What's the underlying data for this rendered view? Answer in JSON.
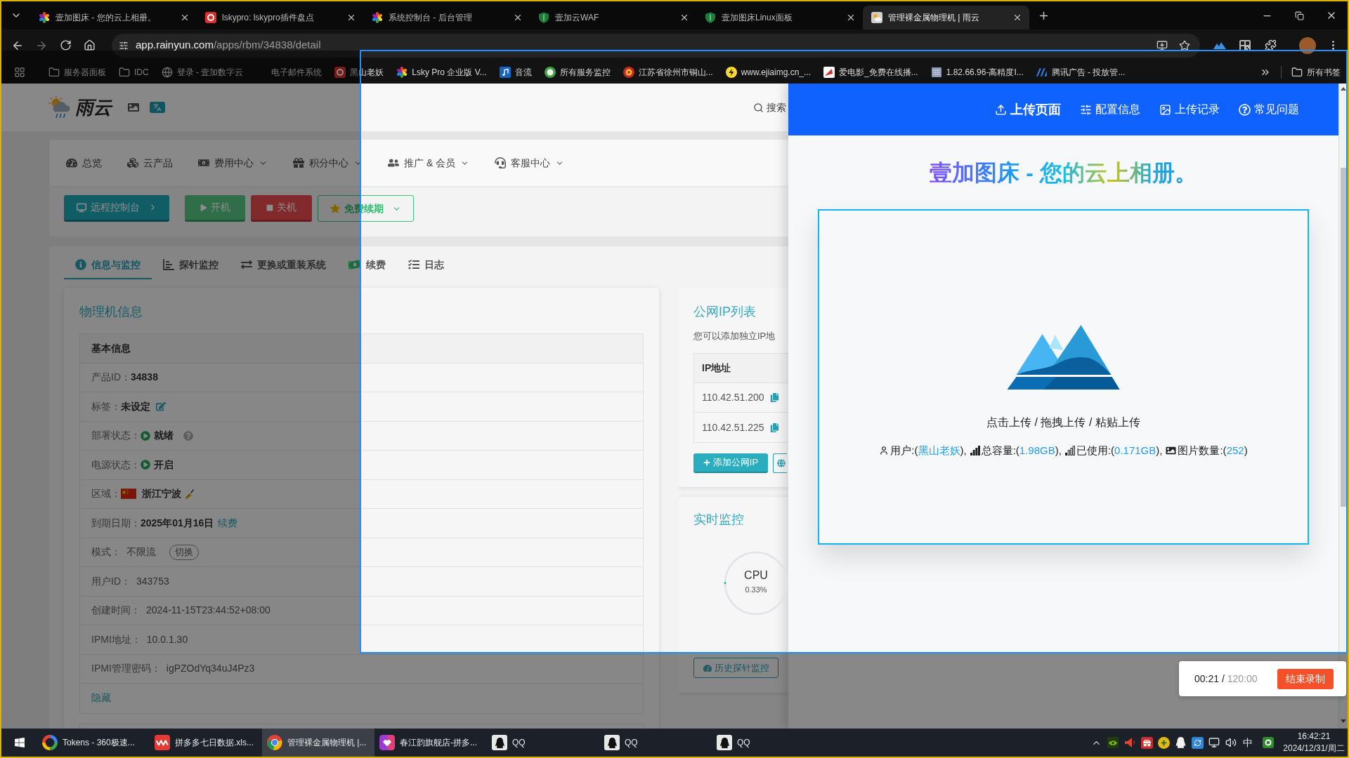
{
  "browser": {
    "tabs": [
      {
        "title": "壹加图床 - 您的云上相册。",
        "kind": "pinwheel",
        "selected": false
      },
      {
        "title": "lskypro: lskypro插件盘点",
        "kind": "badge",
        "selected": false
      },
      {
        "title": "系统控制台 - 后台管理",
        "kind": "pinwheel",
        "selected": false
      },
      {
        "title": "壹加云WAF",
        "kind": "shield",
        "selected": false
      },
      {
        "title": "壹加图床Linux面板",
        "kind": "shield",
        "selected": false
      },
      {
        "title": "管理裸金属物理机 | 雨云",
        "kind": "cloud",
        "selected": true
      }
    ],
    "address": {
      "host": "app.rainyun.com",
      "path": "/apps/rbm/34838/detail"
    },
    "bookmarks": [
      {
        "label": "服务器面板",
        "kind": "folder"
      },
      {
        "label": "IDC",
        "kind": "folder"
      },
      {
        "label": "登录 - 壹加数字云",
        "kind": "globe"
      },
      {
        "label": "电子邮件系统",
        "kind": "blank"
      },
      {
        "label": "黑山老妖",
        "kind": "badge"
      },
      {
        "label": "Lsky Pro 企业版 V...",
        "kind": "pinwheel"
      },
      {
        "label": "音流",
        "kind": "music"
      },
      {
        "label": "所有服务监控",
        "kind": "dot"
      },
      {
        "label": "江苏省徐州市铜山...",
        "kind": "emblem"
      },
      {
        "label": "www.ejiaimg.cn_...",
        "kind": "bolt"
      },
      {
        "label": "爱电影_免费在线播...",
        "kind": "tile"
      },
      {
        "label": "1.82.66.96-高精度I...",
        "kind": "server"
      },
      {
        "label": "腾讯广告 - 投放管...",
        "kind": "stripes"
      }
    ],
    "all_bookmarks": "所有书签"
  },
  "site": {
    "logo": "雨云",
    "search": "搜索",
    "nav": [
      {
        "label": "总览",
        "has_menu": false
      },
      {
        "label": "云产品",
        "has_menu": false
      },
      {
        "label": "费用中心",
        "has_menu": true
      },
      {
        "label": "积分中心",
        "has_menu": true
      },
      {
        "label": "推广 & 会员",
        "has_menu": true
      },
      {
        "label": "客服中心",
        "has_menu": true
      }
    ],
    "actions": [
      {
        "label": "远程控制台",
        "kind": "primary"
      },
      {
        "label": "开机",
        "kind": "success"
      },
      {
        "label": "关机",
        "kind": "danger"
      },
      {
        "label": "免费续期",
        "kind": "outline"
      }
    ],
    "tabs": [
      {
        "label": "信息与监控",
        "selected": true
      },
      {
        "label": "探针监控",
        "selected": false
      },
      {
        "label": "更换或重装系统",
        "selected": false
      },
      {
        "label": "续费",
        "selected": false
      },
      {
        "label": "日志",
        "selected": false
      }
    ],
    "info": {
      "title": "物理机信息",
      "rows": [
        {
          "kind": "header",
          "label": "基本信息"
        },
        {
          "kind": "field",
          "label": "产品ID：",
          "value": "34838",
          "bold": true
        },
        {
          "kind": "tag",
          "label": "标签：",
          "value": "未设定",
          "bold": true
        },
        {
          "kind": "status",
          "label": "部署状态：",
          "value": "就绪",
          "bold": true,
          "help": true
        },
        {
          "kind": "status",
          "label": "电源状态：",
          "value": "开启",
          "bold": true,
          "help": false
        },
        {
          "kind": "region",
          "label": "区域：",
          "value": "浙江宁波",
          "bold": true
        },
        {
          "kind": "field",
          "label": "到期日期：",
          "value": "2025年01月16日",
          "bold": true,
          "link": "续费"
        },
        {
          "kind": "field",
          "label": "模式：",
          "value": "不限流",
          "bold": false,
          "button": "切换"
        },
        {
          "kind": "field",
          "label": "用户ID：",
          "value": "343753",
          "bold": false
        },
        {
          "kind": "field",
          "label": "创建时间：",
          "value": "2024-11-15T23:44:52+08:00",
          "bold": false
        },
        {
          "kind": "field",
          "label": "IPMI地址：",
          "value": "10.0.1.30",
          "bold": false
        },
        {
          "kind": "field",
          "label": "IPMI管理密码：",
          "value": "igPZOdYq34uJ4Pz3",
          "bold": false
        },
        {
          "kind": "link",
          "label": "隐藏"
        }
      ]
    },
    "ip": {
      "title": "公网IP列表",
      "note": "您可以添加独立IP地",
      "column": "IP地址",
      "rows": [
        "110.42.51.200",
        "110.42.51.225"
      ],
      "add_button": "添加公网IP"
    },
    "monitor": {
      "title": "实时监控",
      "gauge": {
        "label": "CPU",
        "reading": "0.33%",
        "level": 0.0033
      },
      "history_button": "历史探针监控"
    }
  },
  "uploader": {
    "tabs": [
      {
        "label": "上传页面",
        "selected": true
      },
      {
        "label": "配置信息",
        "selected": false
      },
      {
        "label": "上传记录",
        "selected": false
      },
      {
        "label": "常见问题",
        "selected": false
      }
    ],
    "title": "壹加图床 - 您的云上相册。",
    "hint": "点击上传 / 拖拽上传 / 粘贴上传",
    "stats": [
      {
        "label": "用户:(",
        "value": "黑山老妖",
        "close": "),"
      },
      {
        "label": "总容量:(",
        "value": "1.98GB",
        "close": "),"
      },
      {
        "label": "已使用:(",
        "value": "0.171GB",
        "close": "),"
      },
      {
        "label": "图片数量:(",
        "value": "252",
        "close": ")"
      }
    ]
  },
  "recorder": {
    "elapsed": "00:21",
    "divider": "/",
    "limit": "120:00",
    "stop_button": "结束录制"
  },
  "taskbar": {
    "items": [
      {
        "label": "Tokens - 360极速...",
        "kind": "ring",
        "selected": false
      },
      {
        "label": "拼多多七日数据.xls...",
        "kind": "zigzag",
        "selected": false
      },
      {
        "label": "管理裸金属物理机 |...",
        "kind": "browser",
        "selected": true
      },
      {
        "label": "春江韵旗舰店-拼多...",
        "kind": "store",
        "selected": false
      },
      {
        "label": "QQ",
        "kind": "penguin",
        "selected": false
      },
      {
        "label": "QQ",
        "kind": "penguin",
        "selected": false
      },
      {
        "label": "QQ",
        "kind": "penguin",
        "selected": false
      }
    ],
    "ime": "中",
    "time": "16:42:21",
    "date": "2024/12/31/周二"
  }
}
